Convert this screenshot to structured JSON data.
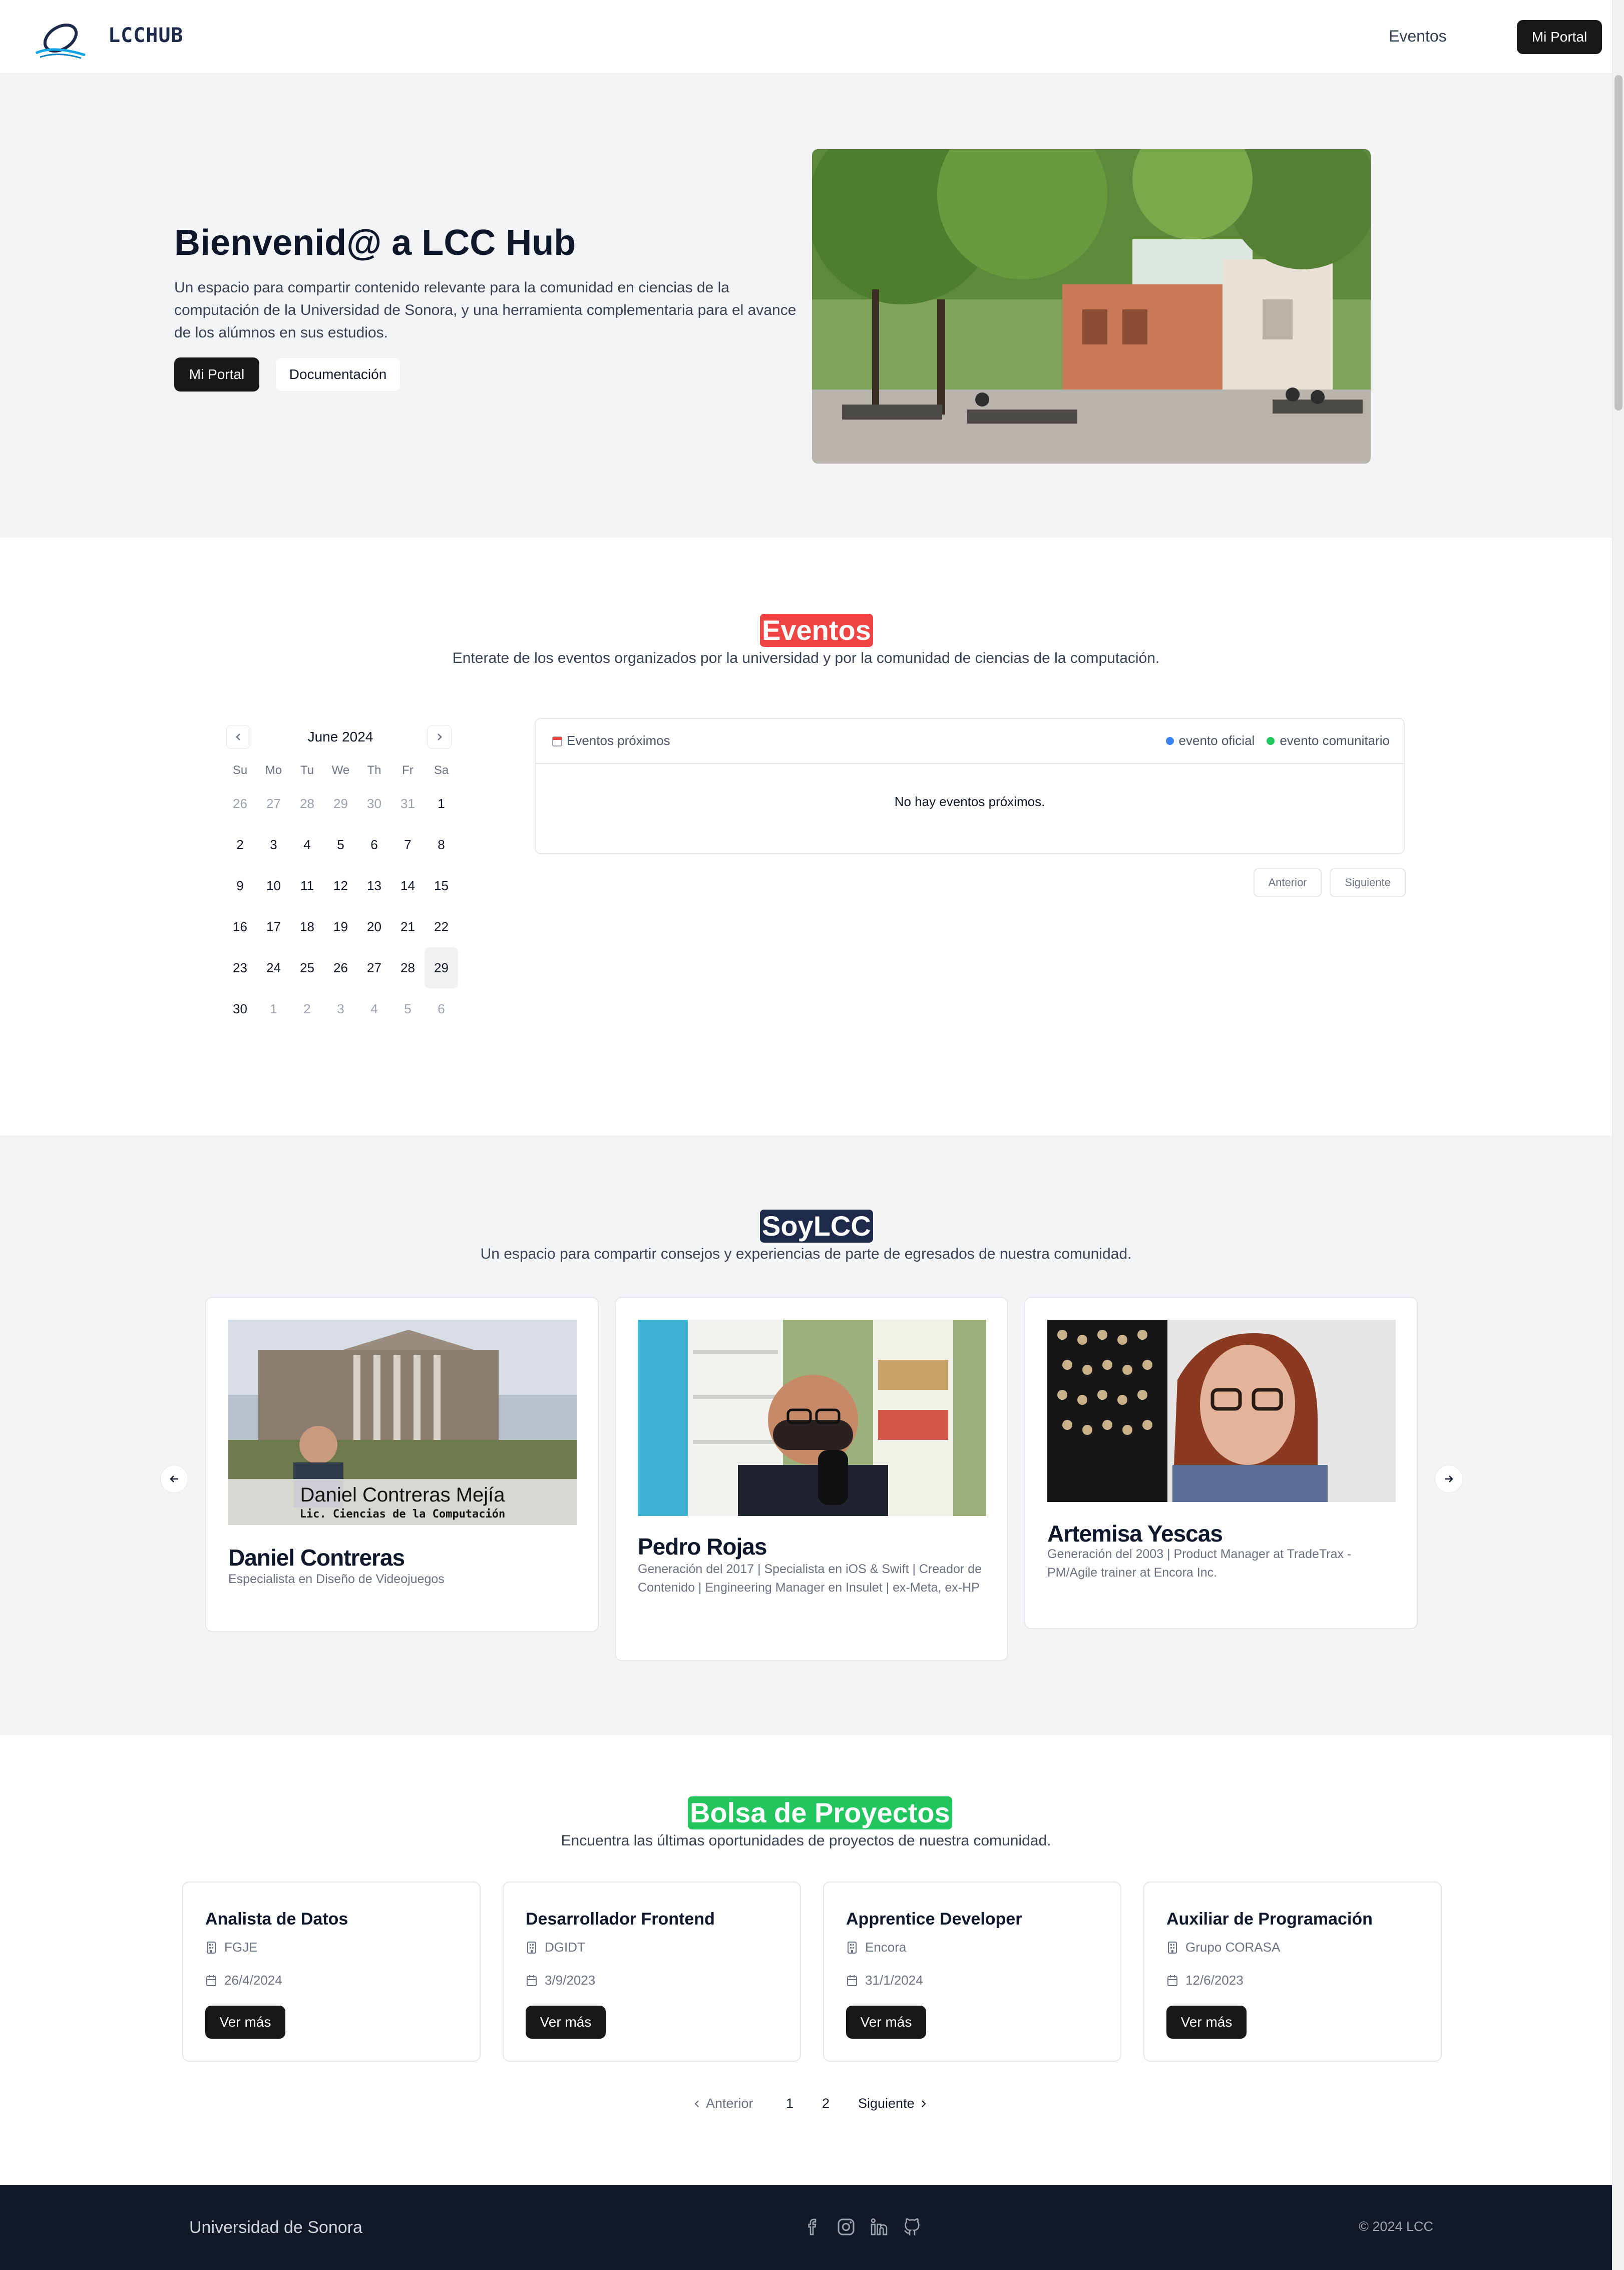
{
  "header": {
    "brand": "LCCHUB",
    "nav_eventos": "Eventos",
    "portal_button": "Mi Portal",
    "logo_icon": "lcc-logo-icon"
  },
  "hero": {
    "title": "Bienvenid@ a LCC Hub",
    "description": "Un espacio para compartir contenido relevante para la comunidad en ciencias de la computación de la Universidad de Sonora, y una herramienta complementaria para el avance de los alúmnos en sus estudios.",
    "primary_button": "Mi Portal",
    "secondary_button": "Documentación"
  },
  "eventos": {
    "title": "Eventos",
    "subtitle": "Enterate de los eventos organizados por la universidad y por la comunidad de ciencias de la computación.",
    "calendar": {
      "month": "June 2024",
      "weekdays": [
        "Su",
        "Mo",
        "Tu",
        "We",
        "Th",
        "Fr",
        "Sa"
      ],
      "days": [
        "26",
        "27",
        "28",
        "29",
        "30",
        "31",
        "1",
        "2",
        "3",
        "4",
        "5",
        "6",
        "7",
        "8",
        "9",
        "10",
        "11",
        "12",
        "13",
        "14",
        "15",
        "16",
        "17",
        "18",
        "19",
        "20",
        "21",
        "22",
        "23",
        "24",
        "25",
        "26",
        "27",
        "28",
        "29",
        "30",
        "1",
        "2",
        "3",
        "4",
        "5",
        "6"
      ]
    },
    "list_header": "Eventos próximos",
    "legend_official": "evento oficial",
    "legend_community": "evento comunitario",
    "empty_message": "No hay eventos próximos.",
    "prev_button": "Anterior",
    "next_button": "Siguiente",
    "colors": {
      "official": "#3b82f6",
      "community": "#22c55e",
      "title_bg": "#ef4444"
    }
  },
  "soylcc": {
    "title": "SoyLCC",
    "subtitle": "Un espacio para compartir consejos y experiencias de parte de egresados de nuestra comunidad.",
    "cards": [
      {
        "name": "Daniel Contreras",
        "description": "Especialista en Diseño de Videojuegos",
        "caption_name": "Daniel Contreras Mejía",
        "caption_sub": "Lic. Ciencias de la Computación"
      },
      {
        "name": "Pedro Rojas",
        "description": "Generación del 2017 | Specialista en iOS & Swift | Creador de Contenido | Engineering Manager en Insulet | ex-Meta, ex-HP"
      },
      {
        "name": "Artemisa Yescas",
        "description": "Generación del 2003 | Product Manager at TradeTrax - PM/Agile trainer at Encora Inc."
      }
    ]
  },
  "bolsa": {
    "title": "Bolsa de Proyectos",
    "subtitle": "Encuentra las últimas oportunidades de proyectos de nuestra comunidad.",
    "projects": [
      {
        "title": "Analista de Datos",
        "org": "FGJE",
        "date": "26/4/2024",
        "button": "Ver más"
      },
      {
        "title": "Desarrollador Frontend",
        "org": "DGIDT",
        "date": "3/9/2023",
        "button": "Ver más"
      },
      {
        "title": "Apprentice Developer",
        "org": "Encora",
        "date": "31/1/2024",
        "button": "Ver más"
      },
      {
        "title": "Auxiliar de Programación",
        "org": "Grupo CORASA",
        "date": "12/6/2023",
        "button": "Ver más"
      }
    ],
    "pagination": {
      "prev": "Anterior",
      "pages": [
        "1",
        "2"
      ],
      "next": "Siguiente"
    }
  },
  "footer": {
    "university": "Universidad de Sonora",
    "copyright": "© 2024 LCC",
    "icons": [
      "facebook-icon",
      "instagram-icon",
      "linkedin-icon",
      "github-icon"
    ]
  }
}
